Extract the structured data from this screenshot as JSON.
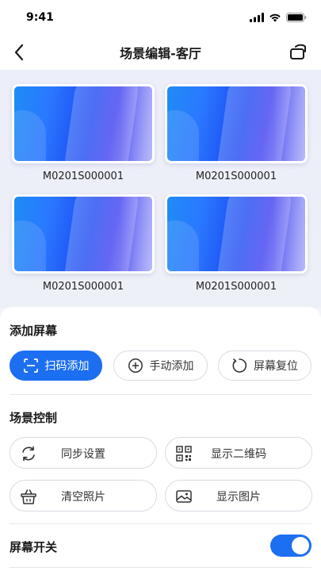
{
  "status_bar": {
    "time": "9:41",
    "icons": [
      "signal-icon",
      "wifi-icon",
      "battery-icon"
    ]
  },
  "nav": {
    "title": "场景编辑-客厅",
    "back_icon": "chevron-left-icon",
    "action_icon": "rotate-icon"
  },
  "screens": [
    {
      "label": "M0201S000001"
    },
    {
      "label": "M0201S000001"
    },
    {
      "label": "M0201S000001"
    },
    {
      "label": "M0201S000001"
    }
  ],
  "add_screen": {
    "title": "添加屏幕",
    "buttons": [
      {
        "label": "扫码添加",
        "icon": "scan-icon"
      },
      {
        "label": "手动添加",
        "icon": "plus-circle-icon"
      },
      {
        "label": "屏幕复位",
        "icon": "reset-icon"
      }
    ]
  },
  "scene_control": {
    "title": "场景控制",
    "buttons": [
      {
        "label": "同步设置",
        "icon": "sync-icon"
      },
      {
        "label": "显示二维码",
        "icon": "qrcode-icon"
      },
      {
        "label": "清空照片",
        "icon": "basket-icon"
      },
      {
        "label": "显示图片",
        "icon": "image-icon"
      }
    ]
  },
  "screen_switch": {
    "title": "屏幕开关",
    "on": true
  },
  "colors": {
    "accent": "#1d6ff2",
    "background": "#f3f4f9"
  }
}
